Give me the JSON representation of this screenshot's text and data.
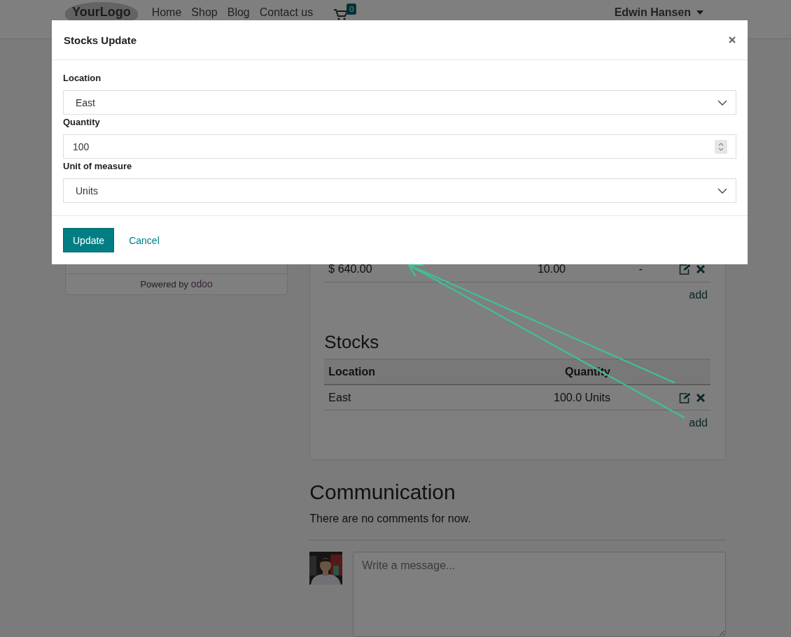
{
  "header": {
    "logo": "YourLogo",
    "nav": [
      {
        "label": "Home"
      },
      {
        "label": "Shop"
      },
      {
        "label": "Blog"
      },
      {
        "label": "Contact us"
      }
    ],
    "cart_count": "0",
    "user": "Edwin Hansen"
  },
  "sidebar": {
    "footer_text": "Powered by",
    "footer_brand": "odoo"
  },
  "pricing_row": {
    "price": "$ 640.00",
    "quantity": "10.00",
    "column_3": "-",
    "add_link": "add"
  },
  "stocks": {
    "title": "Stocks",
    "columns": [
      "Location",
      "Quantity"
    ],
    "rows": [
      {
        "location": "East",
        "quantity": "100.0 Units"
      }
    ],
    "add_link": "add"
  },
  "communication": {
    "title": "Communication",
    "empty_text": "There are no comments for now.",
    "message_placeholder": "Write a message..."
  },
  "modal": {
    "title": "Stocks Update",
    "fields": [
      {
        "kind": "select",
        "label": "Location",
        "value": "East"
      },
      {
        "kind": "number",
        "label": "Quantity",
        "value": "100"
      },
      {
        "kind": "select",
        "label": "Unit of measure",
        "value": "Units"
      }
    ],
    "buttons": [
      {
        "kind": "primary",
        "label": "Update"
      },
      {
        "kind": "link",
        "label": "Cancel"
      }
    ]
  }
}
